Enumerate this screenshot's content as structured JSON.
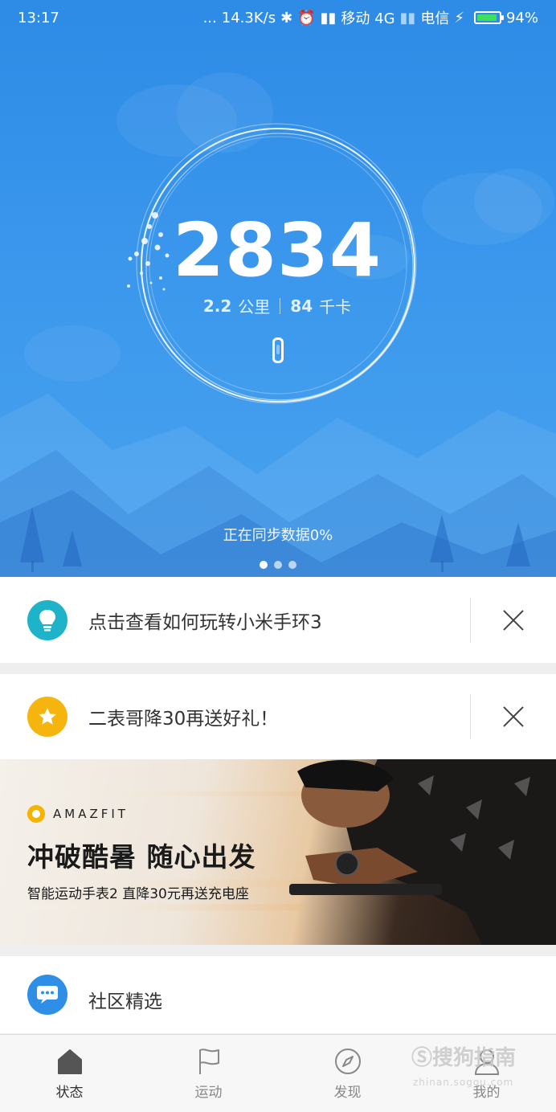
{
  "status_bar": {
    "time": "13:17",
    "dots": "...",
    "net_speed": "14.3K/s",
    "carrier1": "移动 4G",
    "carrier2": "电信",
    "battery": "94%",
    "battery_level": 0.94
  },
  "hero": {
    "steps": "2834",
    "distance_value": "2.2",
    "distance_unit": "公里",
    "calories_value": "84",
    "calories_unit": "千卡",
    "sync_text": "正在同步数据0%",
    "page_dots": 3,
    "active_dot": 0
  },
  "cards": {
    "tip": {
      "text": "点击查看如何玩转小米手环3",
      "icon": "lightbulb-icon",
      "color": "#1fb3c9"
    },
    "promo": {
      "text": "二表哥降30再送好礼！",
      "icon": "star-icon",
      "color": "#f6b40e"
    }
  },
  "banner": {
    "brand": "AMAZFIT",
    "title": "冲破酷暑 随心出发",
    "subtitle": "智能运动手表2 直降30元再送充电座"
  },
  "community": {
    "text": "社区精选",
    "icon": "chat-icon",
    "color": "#2f8fe6"
  },
  "tabs": [
    {
      "label": "状态",
      "icon": "home-icon",
      "active": true
    },
    {
      "label": "运动",
      "icon": "flag-icon",
      "active": false
    },
    {
      "label": "发现",
      "icon": "compass-icon",
      "active": false
    },
    {
      "label": "我的",
      "icon": "person-icon",
      "active": false
    }
  ],
  "watermark": {
    "text": "搜狗指南",
    "sub": "zhinan.sogou.com"
  }
}
